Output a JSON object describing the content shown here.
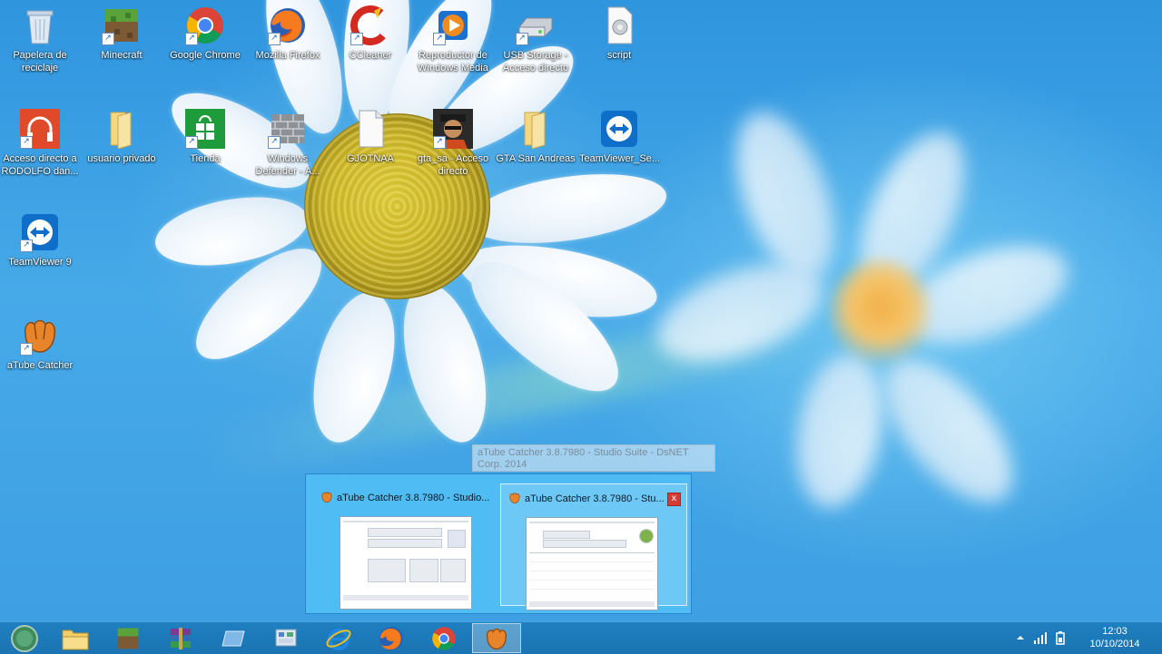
{
  "desktop": {
    "icons": [
      {
        "label": "Papelera de reciclaje",
        "icon": "recycle-bin-icon"
      },
      {
        "label": "Minecraft",
        "icon": "minecraft-icon"
      },
      {
        "label": "Google Chrome",
        "icon": "chrome-icon"
      },
      {
        "label": "Mozilla Firefox",
        "icon": "firefox-icon"
      },
      {
        "label": "CCleaner",
        "icon": "ccleaner-icon"
      },
      {
        "label": "Reproductor de Windows Media",
        "icon": "media-player-icon"
      },
      {
        "label": "USB Storage - Acceso directo",
        "icon": "usb-drive-icon"
      },
      {
        "label": "script",
        "icon": "script-file-icon"
      },
      {
        "label": "Acceso directo a RODOLFO dan...",
        "icon": "headphones-icon"
      },
      {
        "label": "usuario privado",
        "icon": "folder-icon"
      },
      {
        "label": "Tienda",
        "icon": "store-icon"
      },
      {
        "label": "Windows Defender - A...",
        "icon": "defender-icon"
      },
      {
        "label": "GJOTNAA",
        "icon": "blank-file-icon"
      },
      {
        "label": "gta_sa - Acceso directo",
        "icon": "gta-icon"
      },
      {
        "label": "GTA San Andreas",
        "icon": "folder-icon"
      },
      {
        "label": "TeamViewer_Se...",
        "icon": "teamviewer-icon"
      },
      {
        "label": "TeamViewer 9",
        "icon": "teamviewer-icon"
      },
      {
        "label": "aTube Catcher",
        "icon": "atube-catcher-icon"
      }
    ]
  },
  "tooltip": {
    "text": "aTube Catcher 3.8.7980 - Studio Suite - DsNET Corp. 2014"
  },
  "thumbnails": [
    {
      "title": "aTube Catcher 3.8.7980 - Studio..."
    },
    {
      "title": "aTube Catcher 3.8.7980 - Stu...",
      "close": "x"
    }
  ],
  "taskbar": {
    "buttons": [
      {
        "icon": "start-button-icon"
      },
      {
        "icon": "file-explorer-icon"
      },
      {
        "icon": "minecraft-icon"
      },
      {
        "icon": "winrar-icon"
      },
      {
        "icon": "app-window-icon"
      },
      {
        "icon": "control-panel-icon"
      },
      {
        "icon": "internet-explorer-icon"
      },
      {
        "icon": "firefox-icon"
      },
      {
        "icon": "chrome-icon"
      },
      {
        "icon": "atube-catcher-icon"
      }
    ],
    "clock": {
      "time": "12:03",
      "date": "10/10/2014"
    }
  }
}
